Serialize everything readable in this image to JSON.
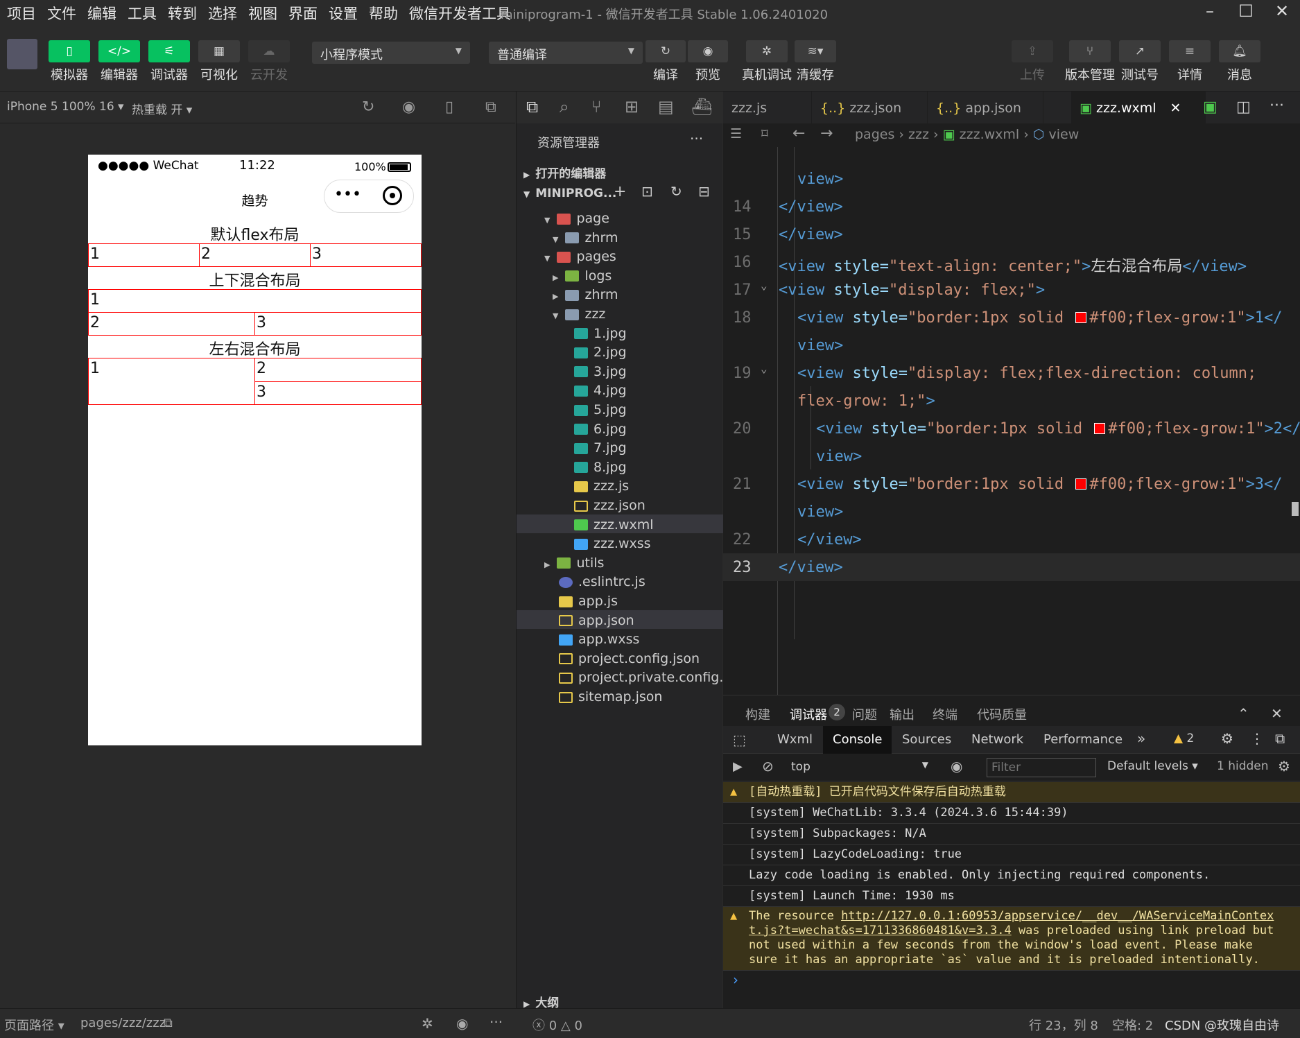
{
  "menu": [
    "项目",
    "文件",
    "编辑",
    "工具",
    "转到",
    "选择",
    "视图",
    "界面",
    "设置",
    "帮助",
    "微信开发者工具"
  ],
  "window_title": "miniprogram-1 - 微信开发者工具 Stable 1.06.2401020",
  "toolbar": {
    "simulator": "模拟器",
    "editor": "编辑器",
    "debugger": "调试器",
    "visual": "可视化",
    "cloud": "云开发",
    "mode": "小程序模式",
    "compile_mode": "普通编译",
    "compile": "编译",
    "preview": "预览",
    "real_debug": "真机调试",
    "clear_cache": "清缓存",
    "upload": "上传",
    "version": "版本管理",
    "test": "测试号",
    "details": "详情",
    "messages": "消息"
  },
  "sim_header": {
    "device": "iPhone 5 100% 16",
    "hot_reload": "热重载 开"
  },
  "phone": {
    "status_left": "●●●●● WeChat",
    "time": "11:22",
    "battery": "100%",
    "nav_title": "趋势",
    "caption1": "默认flex布局",
    "caption2": "上下混合布局",
    "caption3": "左右混合布局",
    "c1": "1",
    "c2": "2",
    "c3": "3"
  },
  "explorer": {
    "title": "资源管理器",
    "open_editors": "打开的编辑器",
    "project": "MINIPROG...",
    "items": [
      "page",
      "zhrm",
      "pages",
      "logs",
      "zhrm",
      "zzz",
      "1.jpg",
      "2.jpg",
      "3.jpg",
      "4.jpg",
      "5.jpg",
      "6.jpg",
      "7.jpg",
      "8.jpg",
      "zzz.js",
      "zzz.json",
      "zzz.wxml",
      "zzz.wxss",
      "utils",
      ".eslintrc.js",
      "app.js",
      "app.json",
      "app.wxss",
      "project.config.json",
      "project.private.config.js...",
      "sitemap.json"
    ],
    "outline": "大纲"
  },
  "tabs": [
    "zzz.js",
    "zzz.json",
    "app.json",
    "zzz.wxml"
  ],
  "breadcrumb": [
    "pages",
    "zzz",
    "zzz.wxml",
    "view"
  ],
  "code": {
    "line_numbers": [
      "14",
      "15",
      "16",
      "17",
      "18",
      "19",
      "20",
      "21",
      "22",
      "23"
    ],
    "l0": "view>",
    "l14": "</view>",
    "l15": "</view>",
    "l16a": "<view ",
    "l16b": "style=",
    "l16c": "\"text-align: center;\"",
    "l16d": ">",
    "l16e": "左右混合布局",
    "l16f": "</view>",
    "l17a": "<view ",
    "l17b": "style=",
    "l17c": "\"display: flex;\"",
    "l17d": ">",
    "l18a": "<view ",
    "l18b": "style=",
    "l18c": "\"border:1px solid ",
    "l18d": "#f00;flex-grow:1\"",
    "l18e": ">1</",
    "l18w": "view>",
    "l19a": "<view ",
    "l19b": "style=",
    "l19c": "\"display: flex;flex-direction: column;",
    "l19w": "flex-grow: 1;\"",
    "l19x": ">",
    "l20e": ">2</",
    "l21e": ">3</",
    "l22": "</view>",
    "l23": "</view>"
  },
  "debug": {
    "tabs": [
      "构建",
      "调试器",
      "问题",
      "输出",
      "终端",
      "代码质量"
    ],
    "badge": "2",
    "devtabs": [
      "Wxml",
      "Console",
      "Sources",
      "Network",
      "Performance"
    ],
    "warn_count": "2",
    "context": "top",
    "filter": "Filter",
    "levels": "Default levels",
    "hidden": "1 hidden",
    "lines": [
      "[自动热重载] 已开启代码文件保存后自动热重载",
      "[system] WeChatLib: 3.3.4 (2024.3.6 15:44:39)",
      "[system] Subpackages: N/A",
      "[system] LazyCodeLoading: true",
      "Lazy code loading is enabled. Only injecting required components.",
      "[system] Launch Time: 1930 ms"
    ],
    "warn2_a": "The resource ",
    "warn2_link1": "http://127.0.0.1:60953/appservice/__dev__/WAServiceMainContex",
    "warn2_link2": "t.js?t=wechat&s=1711336860481&v=3.3.4",
    "warn2_b": " was preloaded using link preload but",
    "warn2_c": "not used within a few seconds from the window's load event. Please make",
    "warn2_d": "sure it has an appropriate `as` value and it is preloaded intentionally.",
    "prompt": "›"
  },
  "status": {
    "page_path": "页面路径",
    "path": "pages/zzz/zzz",
    "errors": "0",
    "warnings": "0",
    "position": "行 23，列 8",
    "spaces": "空格: 2",
    "watermark": "CSDN @玫瑰自由诗"
  }
}
